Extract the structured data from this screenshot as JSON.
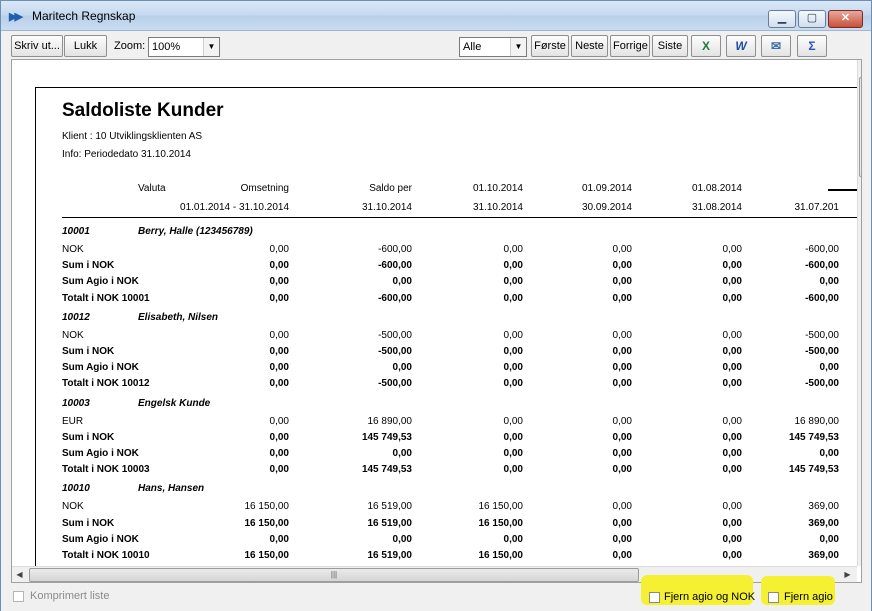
{
  "window": {
    "title": "Maritech Regnskap"
  },
  "toolbar": {
    "print_label": "Skriv ut...",
    "close_label": "Lukk",
    "zoom_label": "Zoom:",
    "zoom_value": "100%",
    "filter_value": "Alle",
    "first_label": "Første",
    "next_label": "Neste",
    "prev_label": "Forrige",
    "last_label": "Siste",
    "excel_icon": "X",
    "word_icon": "W",
    "sum_icon": "Σ"
  },
  "report": {
    "title": "Saldoliste Kunder",
    "client": "Klient :  10  Utviklingsklienten AS",
    "info": "Info:     Periodedato 31.10.2014",
    "columns": [
      {
        "h1": "Valuta",
        "h2": ""
      },
      {
        "h1": "Omsetning",
        "h2": "01.01.2014 - 31.10.2014"
      },
      {
        "h1": "Saldo per",
        "h2": "31.10.2014"
      },
      {
        "h1": "01.10.2014",
        "h2": "31.10.2014"
      },
      {
        "h1": "01.09.2014",
        "h2": "30.09.2014"
      },
      {
        "h1": "01.08.2014",
        "h2": "31.08.2014"
      },
      {
        "h1": "",
        "h2": "31.07.201"
      }
    ],
    "customers": [
      {
        "number": "10001",
        "name": "Berry, Halle  (123456789)",
        "rows": [
          {
            "label": "NOK",
            "bold": false,
            "values": [
              "0,00",
              "-600,00",
              "0,00",
              "0,00",
              "0,00",
              "-600,00"
            ]
          },
          {
            "label": "Sum i NOK",
            "bold": true,
            "values": [
              "0,00",
              "-600,00",
              "0,00",
              "0,00",
              "0,00",
              "-600,00"
            ]
          },
          {
            "label": "Sum Agio i NOK",
            "bold": true,
            "values": [
              "0,00",
              "0,00",
              "0,00",
              "0,00",
              "0,00",
              "0,00"
            ]
          },
          {
            "label": "Totalt i NOK 10001",
            "bold": true,
            "values": [
              "0,00",
              "-600,00",
              "0,00",
              "0,00",
              "0,00",
              "-600,00"
            ]
          }
        ]
      },
      {
        "number": "10012",
        "name": "Elisabeth, Nilsen",
        "rows": [
          {
            "label": "NOK",
            "bold": false,
            "values": [
              "0,00",
              "-500,00",
              "0,00",
              "0,00",
              "0,00",
              "-500,00"
            ]
          },
          {
            "label": "Sum i NOK",
            "bold": true,
            "values": [
              "0,00",
              "-500,00",
              "0,00",
              "0,00",
              "0,00",
              "-500,00"
            ]
          },
          {
            "label": "Sum Agio i NOK",
            "bold": true,
            "values": [
              "0,00",
              "0,00",
              "0,00",
              "0,00",
              "0,00",
              "0,00"
            ]
          },
          {
            "label": "Totalt i NOK 10012",
            "bold": true,
            "values": [
              "0,00",
              "-500,00",
              "0,00",
              "0,00",
              "0,00",
              "-500,00"
            ]
          }
        ]
      },
      {
        "number": "10003",
        "name": "Engelsk Kunde",
        "rows": [
          {
            "label": "EUR",
            "bold": false,
            "values": [
              "0,00",
              "16 890,00",
              "0,00",
              "0,00",
              "0,00",
              "16 890,00"
            ]
          },
          {
            "label": "Sum i NOK",
            "bold": true,
            "values": [
              "0,00",
              "145 749,53",
              "0,00",
              "0,00",
              "0,00",
              "145 749,53"
            ]
          },
          {
            "label": "Sum Agio i NOK",
            "bold": true,
            "values": [
              "0,00",
              "0,00",
              "0,00",
              "0,00",
              "0,00",
              "0,00"
            ]
          },
          {
            "label": "Totalt i NOK 10003",
            "bold": true,
            "values": [
              "0,00",
              "145 749,53",
              "0,00",
              "0,00",
              "0,00",
              "145 749,53"
            ]
          }
        ]
      },
      {
        "number": "10010",
        "name": "Hans, Hansen",
        "rows": [
          {
            "label": "NOK",
            "bold": false,
            "values": [
              "16 150,00",
              "16 519,00",
              "16 150,00",
              "0,00",
              "0,00",
              "369,00"
            ]
          },
          {
            "label": "Sum i NOK",
            "bold": true,
            "values": [
              "16 150,00",
              "16 519,00",
              "16 150,00",
              "0,00",
              "0,00",
              "369,00"
            ]
          },
          {
            "label": "Sum Agio i NOK",
            "bold": true,
            "values": [
              "0,00",
              "0,00",
              "0,00",
              "0,00",
              "0,00",
              "0,00"
            ]
          },
          {
            "label": "Totalt i NOK 10010",
            "bold": true,
            "values": [
              "16 150,00",
              "16 519,00",
              "16 150,00",
              "0,00",
              "0,00",
              "369,00"
            ]
          }
        ]
      }
    ]
  },
  "statusbar": {
    "compressed_label": "Komprimert liste",
    "remove_agio_nok_label": "Fjern agio og NOK",
    "remove_agio_label": "Fjern agio",
    "highlight_color": "#f5f032"
  }
}
